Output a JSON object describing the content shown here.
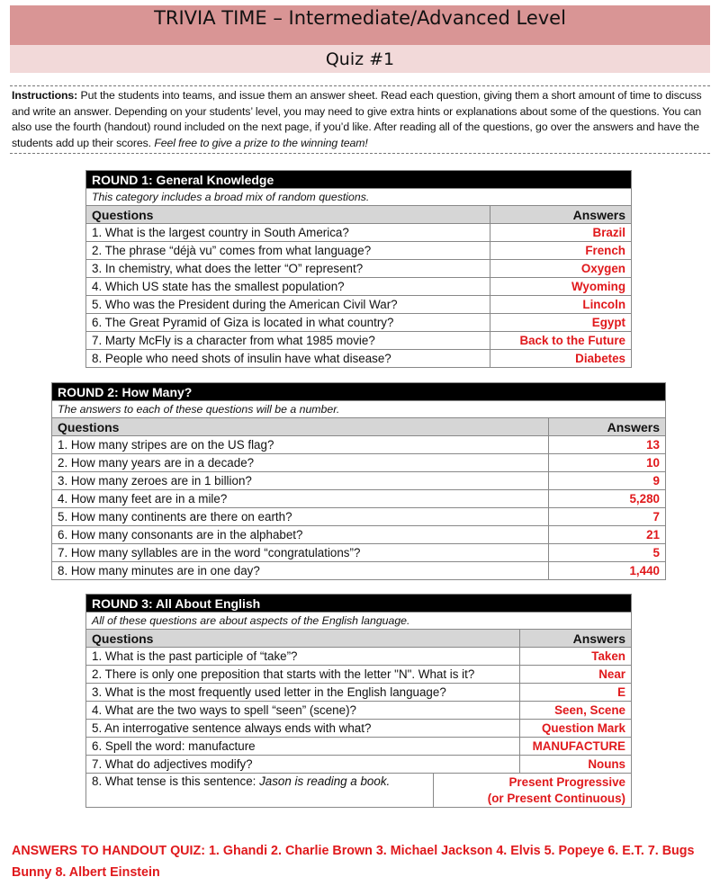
{
  "header": {
    "title": "TRIVIA TIME – Intermediate/Advanced Level",
    "subtitle": "Quiz #1"
  },
  "instructions": {
    "label": "Instructions:",
    "text": " Put the students into teams, and issue them an answer sheet. Read each question, giving them a short amount of time to discuss and write an answer. Depending on your students’ level, you may need to give extra hints or explanations about some of the questions. You can also use the fourth (handout) round included on the next page, if you’d like. After reading all of the questions, go over the answers and have the students add up their scores. ",
    "italic": "Feel free to give a prize to the winning team!"
  },
  "rounds": [
    {
      "title": "ROUND 1: General Knowledge",
      "description": "This category includes a broad mix of random questions.",
      "col_questions": "Questions",
      "col_answers": "Answers",
      "rows": [
        {
          "q": "1. What is the largest country in South America?",
          "a": "Brazil"
        },
        {
          "q": "2. The phrase “déjà vu” comes from what language?",
          "a": "French"
        },
        {
          "q": "3. In chemistry, what does the letter “O” represent?",
          "a": "Oxygen"
        },
        {
          "q": "4. Which US state has the smallest population?",
          "a": "Wyoming"
        },
        {
          "q": "5. Who was the President during the American Civil War?",
          "a": "Lincoln"
        },
        {
          "q": "6. The Great Pyramid of Giza is located in what country?",
          "a": "Egypt"
        },
        {
          "q": "7. Marty McFly is a character from what 1985 movie?",
          "a": "Back to the Future"
        },
        {
          "q": "8. People who need shots of insulin have what disease?",
          "a": "Diabetes"
        }
      ]
    },
    {
      "title": "ROUND 2: How Many?",
      "description": "The answers to each of these questions will be a number.",
      "col_questions": "Questions",
      "col_answers": "Answers",
      "rows": [
        {
          "q": "1. How many stripes are on the US flag?",
          "a": "13"
        },
        {
          "q": "2. How many years are in a decade?",
          "a": "10"
        },
        {
          "q": "3. How many zeroes are in 1 billion?",
          "a": "9"
        },
        {
          "q": "4. How many feet are in a mile?",
          "a": "5,280"
        },
        {
          "q": "5. How many continents are there on earth?",
          "a": "7"
        },
        {
          "q": "6. How many consonants are in the alphabet?",
          "a": "21"
        },
        {
          "q": "7. How many syllables are in the word “congratulations”?",
          "a": "5"
        },
        {
          "q": "8. How many minutes are in one day?",
          "a": "1,440"
        }
      ]
    },
    {
      "title": "ROUND 3: All About English",
      "description": "All of these questions are about aspects of the English language.",
      "col_questions": "Questions",
      "col_answers": "Answers",
      "rows": [
        {
          "q": "1. What is the past participle of “take”?",
          "a": "Taken"
        },
        {
          "q": "2. There is only one preposition that starts with the letter \"N\". What is it?",
          "a": "Near"
        },
        {
          "q": "3. What is the most frequently used letter in the English language?",
          "a": "E"
        },
        {
          "q": "4. What are the two ways to spell “seen” (scene)?",
          "a": "Seen, Scene"
        },
        {
          "q": "5. An interrogative sentence always ends with what?",
          "a": "Question Mark"
        },
        {
          "q": "6.  Spell the word: manufacture",
          "a": "MANUFACTURE"
        },
        {
          "q": "7. What do adjectives modify?",
          "a": "Nouns"
        }
      ],
      "last": {
        "q": "8.  What tense is this sentence: ",
        "q_italic": "Jason is reading a book.",
        "a1": "Present Progressive",
        "a2": "(or Present Continuous)"
      }
    }
  ],
  "footer": {
    "text": "ANSWERS TO HANDOUT QUIZ: 1. Ghandi  2. Charlie Brown  3. Michael Jackson  4. Elvis  5. Popeye  6. E.T.  7. Bugs Bunny  8. Albert Einstein"
  },
  "colors": {
    "header_dark": "#d99595",
    "header_light": "#f2d9d9",
    "answer_red": "#e0191c"
  }
}
